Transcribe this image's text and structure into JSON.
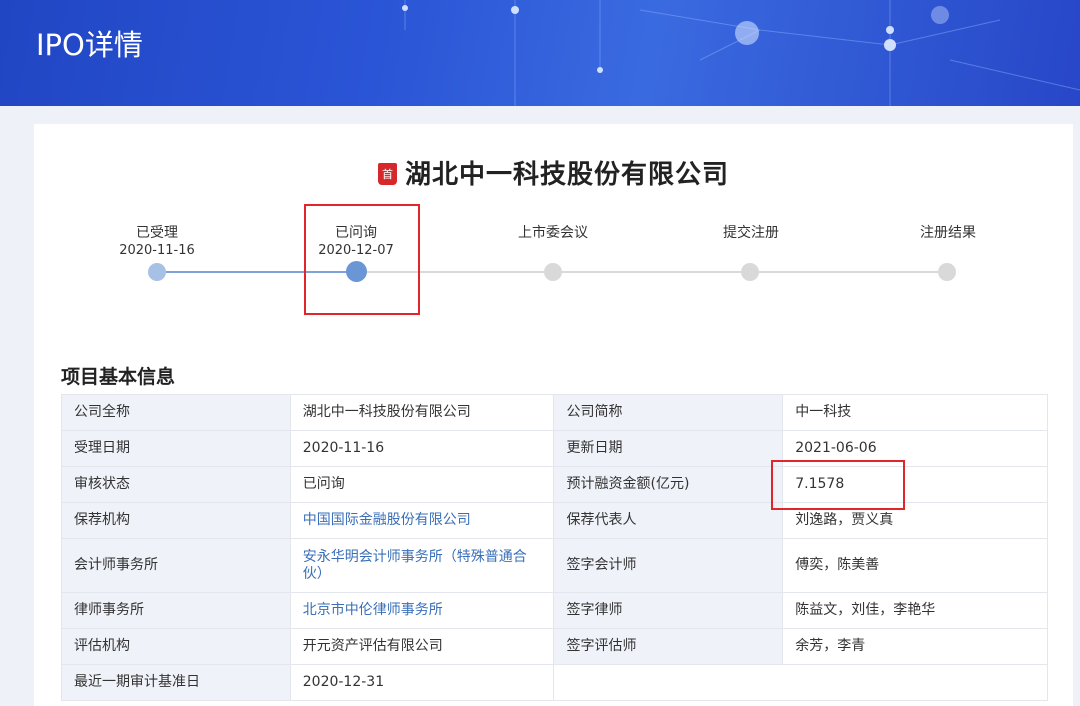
{
  "header": {
    "title": "IPO详情"
  },
  "company": {
    "badge": "首",
    "name": "湖北中一科技股份有限公司"
  },
  "steps": [
    {
      "label": "已受理",
      "date": "2020-11-16",
      "state": "done"
    },
    {
      "label": "已问询",
      "date": "2020-12-07",
      "state": "current"
    },
    {
      "label": "上市委会议",
      "date": "",
      "state": "pending"
    },
    {
      "label": "提交注册",
      "date": "",
      "state": "pending"
    },
    {
      "label": "注册结果",
      "date": "",
      "state": "pending"
    }
  ],
  "section": {
    "title": "项目基本信息"
  },
  "table": {
    "rows": [
      {
        "k1": "公司全称",
        "v1": "湖北中一科技股份有限公司",
        "k2": "公司简称",
        "v2": "中一科技"
      },
      {
        "k1": "受理日期",
        "v1": "2020-11-16",
        "k2": "更新日期",
        "v2": "2021-06-06"
      },
      {
        "k1": "审核状态",
        "v1": "已问询",
        "k2": "预计融资金额(亿元)",
        "v2": "7.1578"
      },
      {
        "k1": "保荐机构",
        "v1": "中国国际金融股份有限公司",
        "k2": "保荐代表人",
        "v2": "刘逸路，贾义真"
      },
      {
        "k1": "会计师事务所",
        "v1": "安永华明会计师事务所（特殊普通合伙）",
        "k2": "签字会计师",
        "v2": "傅奕，陈美善"
      },
      {
        "k1": "律师事务所",
        "v1": "北京市中伦律师事务所",
        "k2": "签字律师",
        "v2": "陈益文，刘佳，李艳华"
      },
      {
        "k1": "评估机构",
        "v1": "开元资产评估有限公司",
        "k2": "签字评估师",
        "v2": "余芳，李青"
      },
      {
        "k1": "最近一期审计基准日",
        "v1": "2020-12-31",
        "k2": "",
        "v2": ""
      }
    ]
  },
  "colors": {
    "accent": "#2a55d6",
    "highlight": "#e0262a",
    "link": "#3a6fb8"
  }
}
